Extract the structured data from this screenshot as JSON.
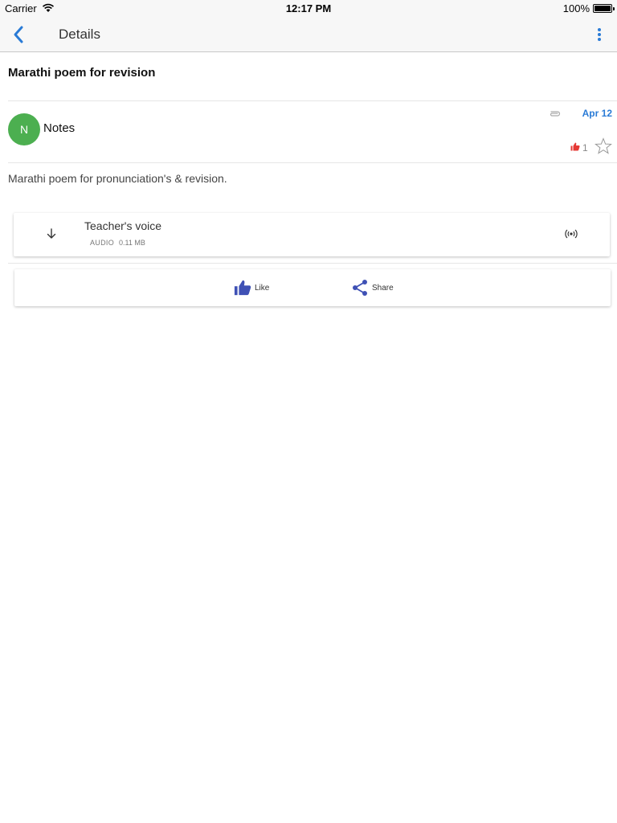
{
  "status_bar": {
    "carrier": "Carrier",
    "time": "12:17 PM",
    "battery": "100%"
  },
  "nav": {
    "title": "Details",
    "back_icon": "chevron-left-icon",
    "menu_icon": "more-vertical-icon"
  },
  "post": {
    "title": "Marathi poem for revision",
    "author_initial": "N",
    "author": "Notes",
    "date": "Apr 12",
    "like_count": "1",
    "description": "Marathi poem for pronunciation's & revision."
  },
  "attachment": {
    "name": "Teacher's voice",
    "type": "AUDIO",
    "size": "0.11 MB"
  },
  "actions": {
    "like_label": "Like",
    "share_label": "Share"
  },
  "colors": {
    "accent": "#2a7bd6",
    "avatar": "#4caf50",
    "action_icon": "#3f51b5",
    "like_red": "#e53935"
  }
}
